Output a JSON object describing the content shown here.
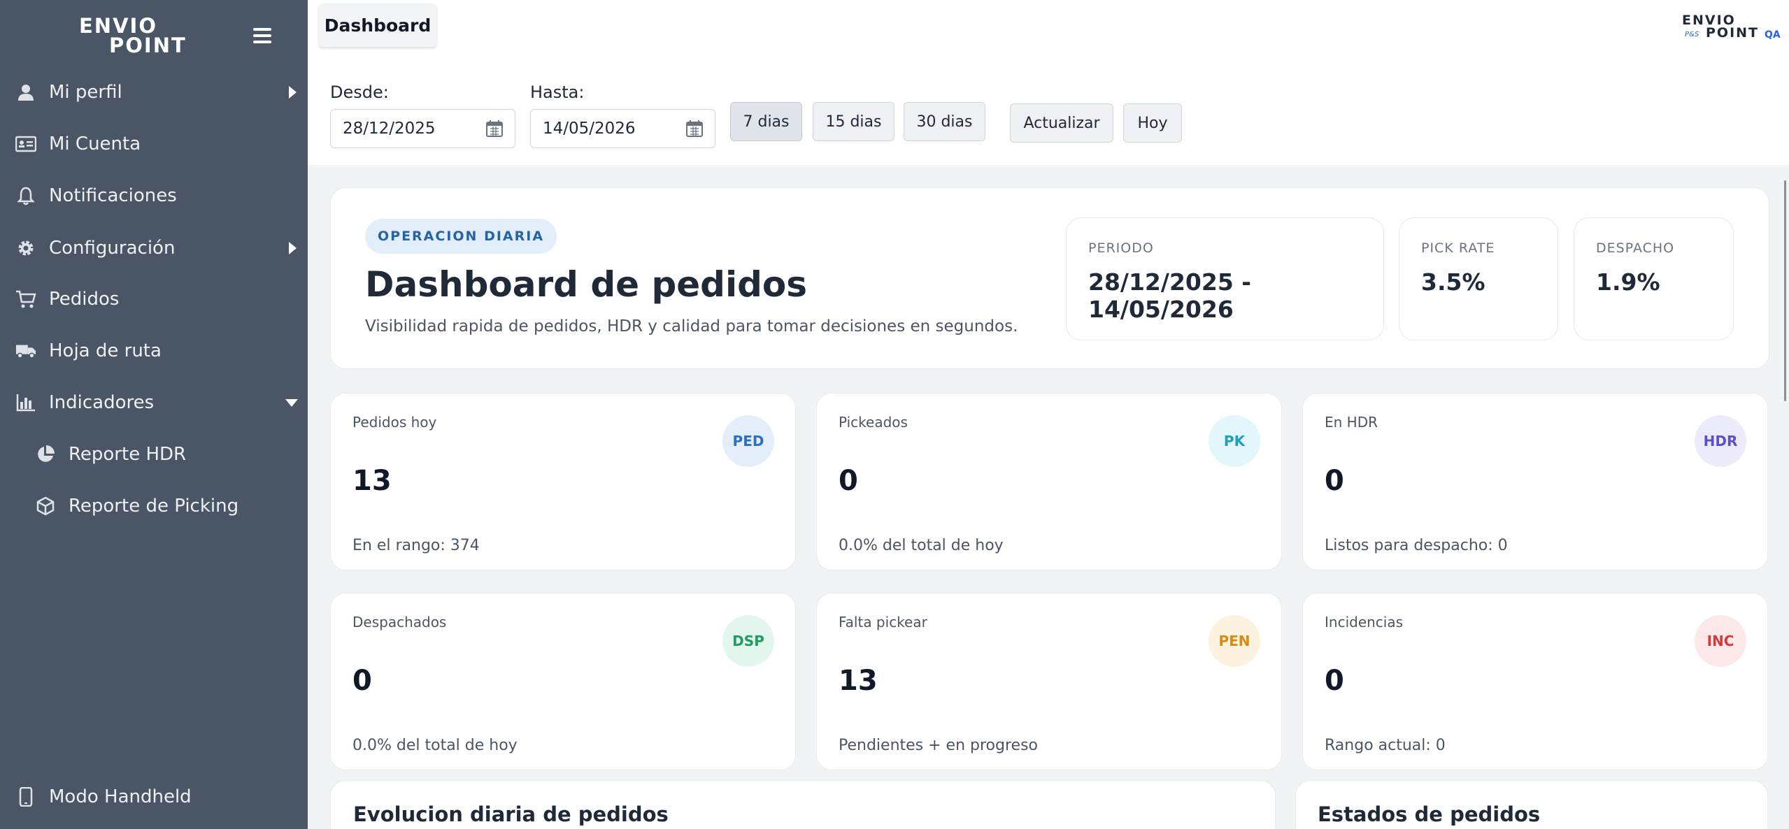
{
  "sidebar": {
    "logo_line1": "ENVIO",
    "logo_line2": "POINT",
    "items": [
      {
        "label": "Mi perfil"
      },
      {
        "label": "Mi Cuenta"
      },
      {
        "label": "Notificaciones"
      },
      {
        "label": "Configuración"
      },
      {
        "label": "Pedidos"
      },
      {
        "label": "Hoja de ruta"
      },
      {
        "label": "Indicadores"
      },
      {
        "label": "Reporte HDR"
      },
      {
        "label": "Reporte de Picking"
      }
    ],
    "footer_label": "Modo Handheld"
  },
  "header": {
    "tab_label": "Dashboard",
    "brand_line1": "ENVIO",
    "brand_line2": "POINT",
    "brand_small": "P&S",
    "brand_env": "QA"
  },
  "filters": {
    "from_label": "Desde:",
    "from_value": "28/12/2025",
    "to_label": "Hasta:",
    "to_value": "14/05/2026",
    "range_buttons": [
      "7 dias",
      "15 dias",
      "30 dias"
    ],
    "active_range": "7 dias",
    "refresh_label": "Actualizar",
    "today_label": "Hoy"
  },
  "hero": {
    "badge": "OPERACION DIARIA",
    "title": "Dashboard de pedidos",
    "subtitle": "Visibilidad rapida de pedidos, HDR y calidad para tomar decisiones en segundos.",
    "metrics": [
      {
        "label": "PERIODO",
        "value": "28/12/2025 - 14/05/2026"
      },
      {
        "label": "PICK RATE",
        "value": "3.5%"
      },
      {
        "label": "DESPACHO",
        "value": "1.9%"
      }
    ]
  },
  "stats": [
    {
      "title": "Pedidos hoy",
      "chip": "PED",
      "value": "13",
      "sub": "En el rango: 374",
      "chip_bg": "#e4eefb",
      "chip_color": "#2f6fc0"
    },
    {
      "title": "Pickeados",
      "chip": "PK",
      "value": "0",
      "sub": "0.0% del total de hoy",
      "chip_bg": "#e2f6fb",
      "chip_color": "#1f9fbf"
    },
    {
      "title": "En HDR",
      "chip": "HDR",
      "value": "0",
      "sub": "Listos para despacho: 0",
      "chip_bg": "#ecebfb",
      "chip_color": "#5b50c8"
    },
    {
      "title": "Despachados",
      "chip": "DSP",
      "value": "0",
      "sub": "0.0% del total de hoy",
      "chip_bg": "#e3f6ee",
      "chip_color": "#1e9e63"
    },
    {
      "title": "Falta pickear",
      "chip": "PEN",
      "value": "13",
      "sub": "Pendientes + en progreso",
      "chip_bg": "#fdf1df",
      "chip_color": "#d98a17"
    },
    {
      "title": "Incidencias",
      "chip": "INC",
      "value": "0",
      "sub": "Rango actual: 0",
      "chip_bg": "#fce8e8",
      "chip_color": "#d23b3b"
    }
  ],
  "sections": {
    "evolution_title": "Evolucion diaria de pedidos",
    "states_title": "Estados de pedidos"
  },
  "icons": [
    "user-icon",
    "id-card-icon",
    "bell-icon",
    "gear-icon",
    "cart-icon",
    "truck-icon",
    "bar-chart-icon",
    "pie-chart-icon",
    "box-icon",
    "phone-icon",
    "calendar-icon",
    "hamburger-icon"
  ]
}
